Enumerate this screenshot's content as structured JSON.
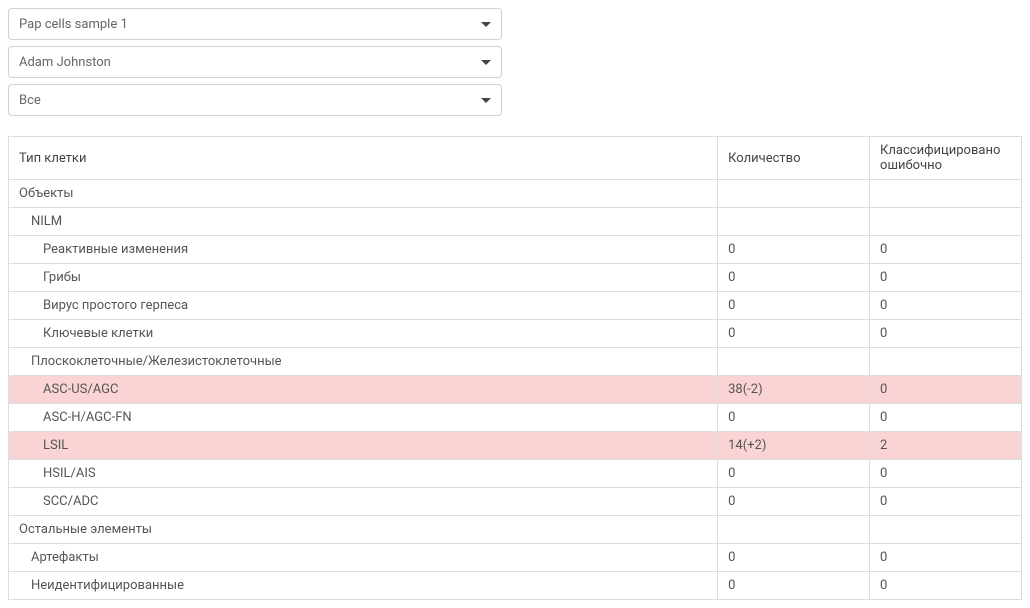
{
  "dropdowns": {
    "sample": {
      "value": "Pap cells sample 1"
    },
    "user": {
      "value": "Adam Johnston"
    },
    "filter": {
      "value": "Все"
    }
  },
  "table": {
    "headers": {
      "type": "Тип клетки",
      "quantity": "Количество",
      "errors": "Классифицировано ошибочно"
    },
    "rows": [
      {
        "label": "Объекты",
        "indent": 0,
        "qty": "",
        "err": "",
        "highlight": false
      },
      {
        "label": "NILM",
        "indent": 1,
        "qty": "",
        "err": "",
        "highlight": false
      },
      {
        "label": "Реактивные изменения",
        "indent": 2,
        "qty": "0",
        "err": "0",
        "highlight": false
      },
      {
        "label": "Грибы",
        "indent": 2,
        "qty": "0",
        "err": "0",
        "highlight": false
      },
      {
        "label": "Вирус простого герпеса",
        "indent": 2,
        "qty": "0",
        "err": "0",
        "highlight": false
      },
      {
        "label": "Ключевые клетки",
        "indent": 2,
        "qty": "0",
        "err": "0",
        "highlight": false
      },
      {
        "label": "Плоскоклеточные/Железистоклеточные",
        "indent": 1,
        "qty": "",
        "err": "",
        "highlight": false
      },
      {
        "label": "ASC-US/AGC",
        "indent": 2,
        "qty": "38(-2)",
        "err": "0",
        "highlight": true
      },
      {
        "label": "ASC-H/AGC-FN",
        "indent": 2,
        "qty": "0",
        "err": "0",
        "highlight": false
      },
      {
        "label": "LSIL",
        "indent": 2,
        "qty": "14(+2)",
        "err": "2",
        "highlight": true
      },
      {
        "label": "HSIL/AIS",
        "indent": 2,
        "qty": "0",
        "err": "0",
        "highlight": false
      },
      {
        "label": "SCC/ADC",
        "indent": 2,
        "qty": "0",
        "err": "0",
        "highlight": false
      },
      {
        "label": "Остальные элементы",
        "indent": 0,
        "qty": "",
        "err": "",
        "highlight": false
      },
      {
        "label": "Артефакты",
        "indent": 1,
        "qty": "0",
        "err": "0",
        "highlight": false
      },
      {
        "label": "Неидентифицированные",
        "indent": 1,
        "qty": "0",
        "err": "0",
        "highlight": false
      }
    ]
  }
}
